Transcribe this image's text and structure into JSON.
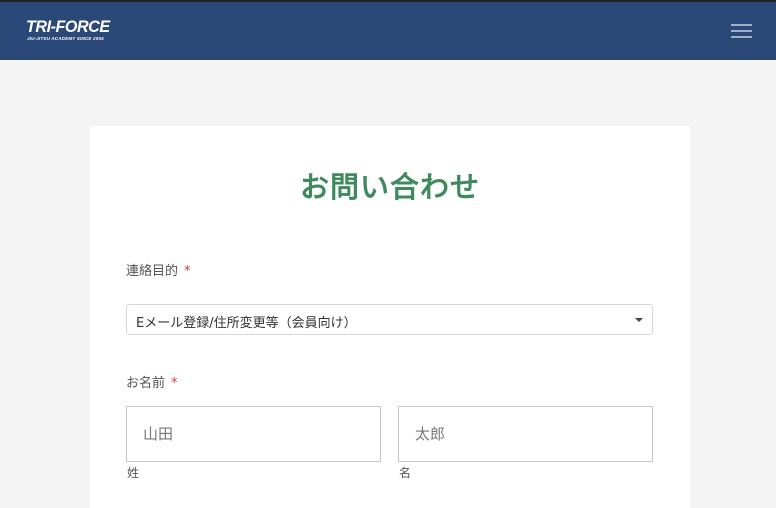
{
  "header": {
    "logo_main": "TRI-FORCE",
    "logo_sub": "JIU-JITSU ACADEMY SINCE 2004",
    "menu_icon": "hamburger-menu-icon",
    "background_color": "#2a4878"
  },
  "form": {
    "title": "お問い合わせ",
    "title_color": "#3e8a5e",
    "required_mark": "*",
    "purpose": {
      "label": "連絡目的",
      "selected_value": "Eメール登録/住所変更等（会員向け）"
    },
    "name": {
      "label": "お名前",
      "last_name": {
        "placeholder": "山田",
        "sublabel": "姓"
      },
      "first_name": {
        "placeholder": "太郎",
        "sublabel": "名"
      }
    }
  }
}
